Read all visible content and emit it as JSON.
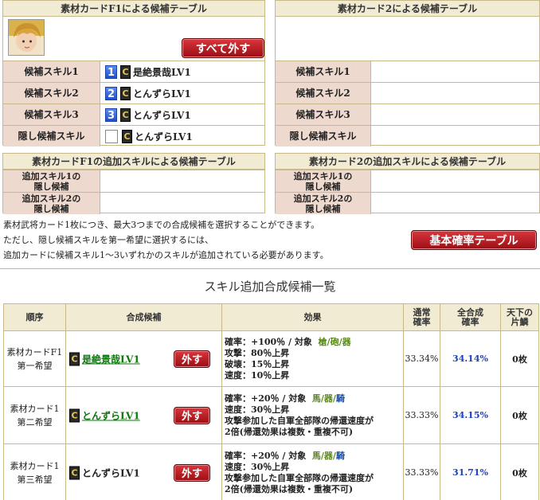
{
  "card1": {
    "title": "素材カードF1による候補テーブル",
    "remove_all": "すべて外す",
    "skills": [
      {
        "label": "候補スキル1",
        "num": "1",
        "rank": "C",
        "skill": "是絶景哉LV1"
      },
      {
        "label": "候補スキル2",
        "num": "2",
        "rank": "C",
        "skill": "とんずらLV1"
      },
      {
        "label": "候補スキル3",
        "num": "3",
        "rank": "C",
        "skill": "とんずらLV1"
      },
      {
        "label": "隠し候補スキル",
        "num": "",
        "rank": "C",
        "skill": "とんずらLV1"
      }
    ]
  },
  "card2": {
    "title": "素材カード2による候補テーブル",
    "labels": [
      "候補スキル1",
      "候補スキル2",
      "候補スキル3",
      "隠し候補スキル"
    ]
  },
  "add1": {
    "title": "素材カードF1の追加スキルによる候補テーブル",
    "rows": [
      {
        "l1": "追加スキル1の",
        "l2": "隠し候補"
      },
      {
        "l1": "追加スキル2の",
        "l2": "隠し候補"
      }
    ]
  },
  "add2": {
    "title": "素材カード2の追加スキルによる候補テーブル",
    "rows": [
      {
        "l1": "追加スキル1の",
        "l2": "隠し候補"
      },
      {
        "l1": "追加スキル2の",
        "l2": "隠し候補"
      }
    ]
  },
  "info": [
    "素材武将カード1枚につき、最大3つまでの合成候補を選択することができます。",
    "ただし、隠し候補スキルを第一希望に選択するには、",
    "追加カードに候補スキル1～3いずれかのスキルが追加されている必要があります。"
  ],
  "base_table_button": "基本確率テーブル",
  "section_title": "スキル追加合成候補一覧",
  "table": {
    "headers": {
      "order": "順序",
      "cand": "合成候補",
      "effect": "効果",
      "rate_1": "通常",
      "rate_2": "確率",
      "total_1": "全合成",
      "total_2": "確率",
      "piece_1": "天下の",
      "piece_2": "片鱗"
    },
    "rows": [
      {
        "order_1": "素材カードF1",
        "order_2": "第一希望",
        "rank": "C",
        "skill": "是絶景哉LV1",
        "remove": "外す",
        "eff_1": "確率：+100％ / 対象",
        "target_a": "槍",
        "sep_1": "/",
        "target_b": "砲",
        "sep_2": "/",
        "target_c": "器",
        "lines": [
          "攻撃：80％上昇",
          "破壊：15％上昇",
          "速度：10％上昇"
        ],
        "rate": "33.34%",
        "total": "34.14%",
        "piece": "0枚"
      },
      {
        "order_1": "素材カード1",
        "order_2": "第二希望",
        "rank": "C",
        "skill": "とんずらLV1",
        "remove": "外す",
        "eff_1": "確率：+20％ / 対象",
        "target_a": "馬",
        "sep_1": "/",
        "target_b": "器",
        "sep_2": "/",
        "target_c": "騎",
        "lines": [
          "速度：30％上昇",
          "攻撃参加した自軍全部隊の帰還速度が",
          "2倍(帰還効果は複数・重複不可)"
        ],
        "rate": "33.33%",
        "total": "34.15%",
        "piece": "0枚"
      },
      {
        "order_1": "素材カード1",
        "order_2": "第三希望",
        "rank": "C",
        "skill": "とんずらLV1",
        "remove": "外す",
        "eff_1": "確率：+20％ / 対象",
        "target_a": "馬",
        "sep_1": "/",
        "target_b": "器",
        "sep_2": "/",
        "target_c": "騎",
        "lines": [
          "速度：30％上昇",
          "攻撃参加した自軍全部隊の帰還速度が",
          "2倍(帰還効果は複数・重複不可)"
        ],
        "rate": "33.33%",
        "total": "31.71%",
        "piece": "0枚"
      }
    ]
  }
}
